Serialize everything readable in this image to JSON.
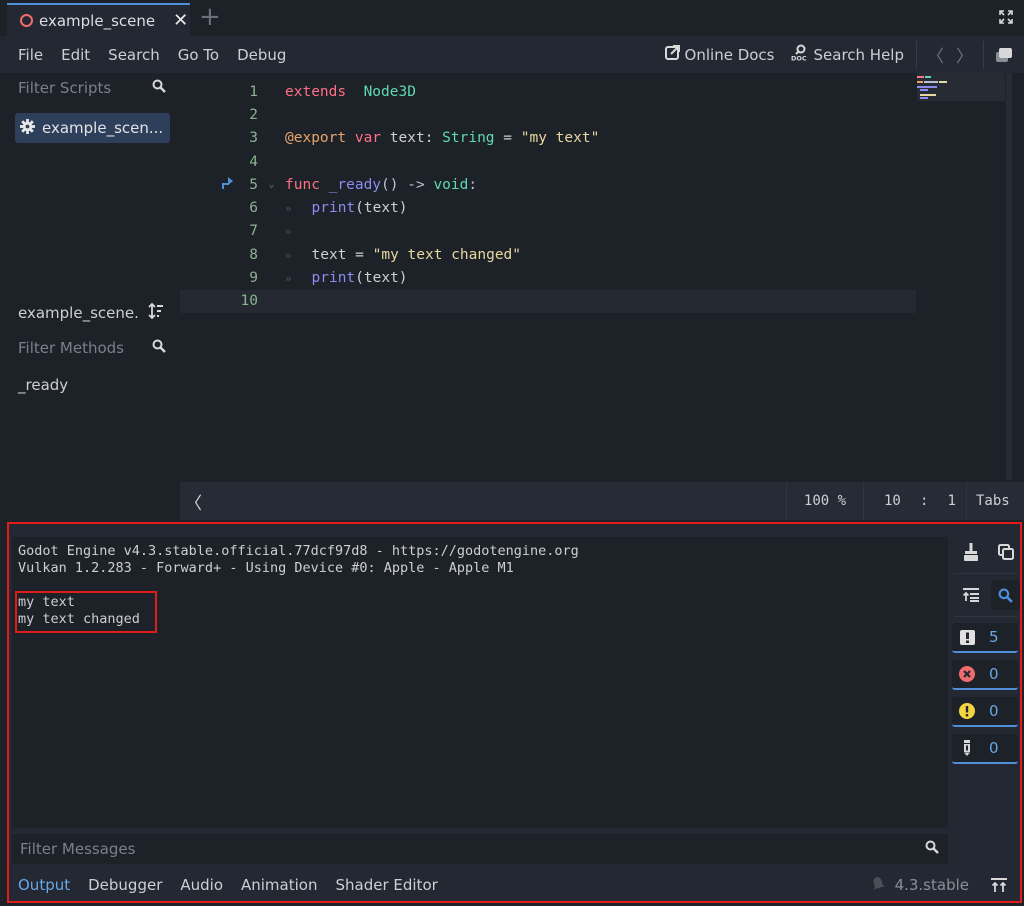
{
  "tabs": {
    "scene_tab_label": "example_scene",
    "scene_tab_close": "✕",
    "add_tab": "+",
    "fullscreen_icon": "⤢"
  },
  "menu": {
    "items": [
      "File",
      "Edit",
      "Search",
      "Go To",
      "Debug"
    ],
    "online_docs": "Online Docs",
    "search_help": "Search Help",
    "back": "〈",
    "forward": "〉"
  },
  "scripts_panel": {
    "filter_placeholder": "Filter Scripts",
    "scripts": [
      "example_scen..."
    ],
    "current_script": "example_scene.g",
    "methods_filter_placeholder": "Filter Methods",
    "methods": [
      "_ready"
    ]
  },
  "editor": {
    "lines": [
      {
        "n": "1",
        "tokens": [
          [
            "kw",
            "extends"
          ],
          [
            "",
            "  "
          ],
          [
            "type",
            "Node3D"
          ]
        ]
      },
      {
        "n": "2",
        "tokens": []
      },
      {
        "n": "3",
        "tokens": [
          [
            "ann",
            "@export"
          ],
          [
            "",
            " "
          ],
          [
            "kw",
            "var"
          ],
          [
            "",
            " text: "
          ],
          [
            "type",
            "String"
          ],
          [
            "",
            " = "
          ],
          [
            "str",
            "\"my text\""
          ]
        ]
      },
      {
        "n": "4",
        "tokens": []
      },
      {
        "n": "5",
        "tokens": [
          [
            "kw",
            "func"
          ],
          [
            "",
            " "
          ],
          [
            "fn2",
            "_ready"
          ],
          [
            "sym",
            "() -> "
          ],
          [
            "type",
            "void"
          ],
          [
            "sym",
            ":"
          ]
        ]
      },
      {
        "n": "6",
        "tokens": [
          [
            "tab",
            "  "
          ],
          [
            "fn",
            "print"
          ],
          [
            "",
            "(text)"
          ]
        ]
      },
      {
        "n": "7",
        "tokens": [
          [
            "tab",
            ""
          ]
        ]
      },
      {
        "n": "8",
        "tokens": [
          [
            "tab",
            "  "
          ],
          [
            "",
            "text = "
          ],
          [
            "str",
            "\"my text changed\""
          ]
        ]
      },
      {
        "n": "9",
        "tokens": [
          [
            "tab",
            "  "
          ],
          [
            "fn",
            "print"
          ],
          [
            "",
            "(text)"
          ]
        ]
      },
      {
        "n": "10",
        "tokens": []
      }
    ],
    "current_line": 10
  },
  "statusbar": {
    "back": "〈",
    "zoom": "100 %",
    "line": "10",
    "col_sep": ":",
    "column": "1",
    "indent": "Tabs"
  },
  "output": {
    "lines": [
      "Godot Engine v4.3.stable.official.77dcf97d8 - https://godotengine.org",
      "Vulkan 1.2.283 - Forward+ - Using Device #0: Apple - Apple M1",
      "",
      "my text",
      "my text changed"
    ],
    "filter_placeholder": "Filter Messages",
    "counters": {
      "messages": "5",
      "errors": "0",
      "warnings": "0",
      "editor": "0"
    }
  },
  "bottom_tabs": {
    "items": [
      "Output",
      "Debugger",
      "Audio",
      "Animation",
      "Shader Editor"
    ],
    "active": "Output",
    "version": "4.3.stable"
  },
  "colors": {
    "accent": "#4f8fd8",
    "highlight_border": "#e21b1b",
    "error": "#f06c6c",
    "warning": "#f5d442"
  }
}
